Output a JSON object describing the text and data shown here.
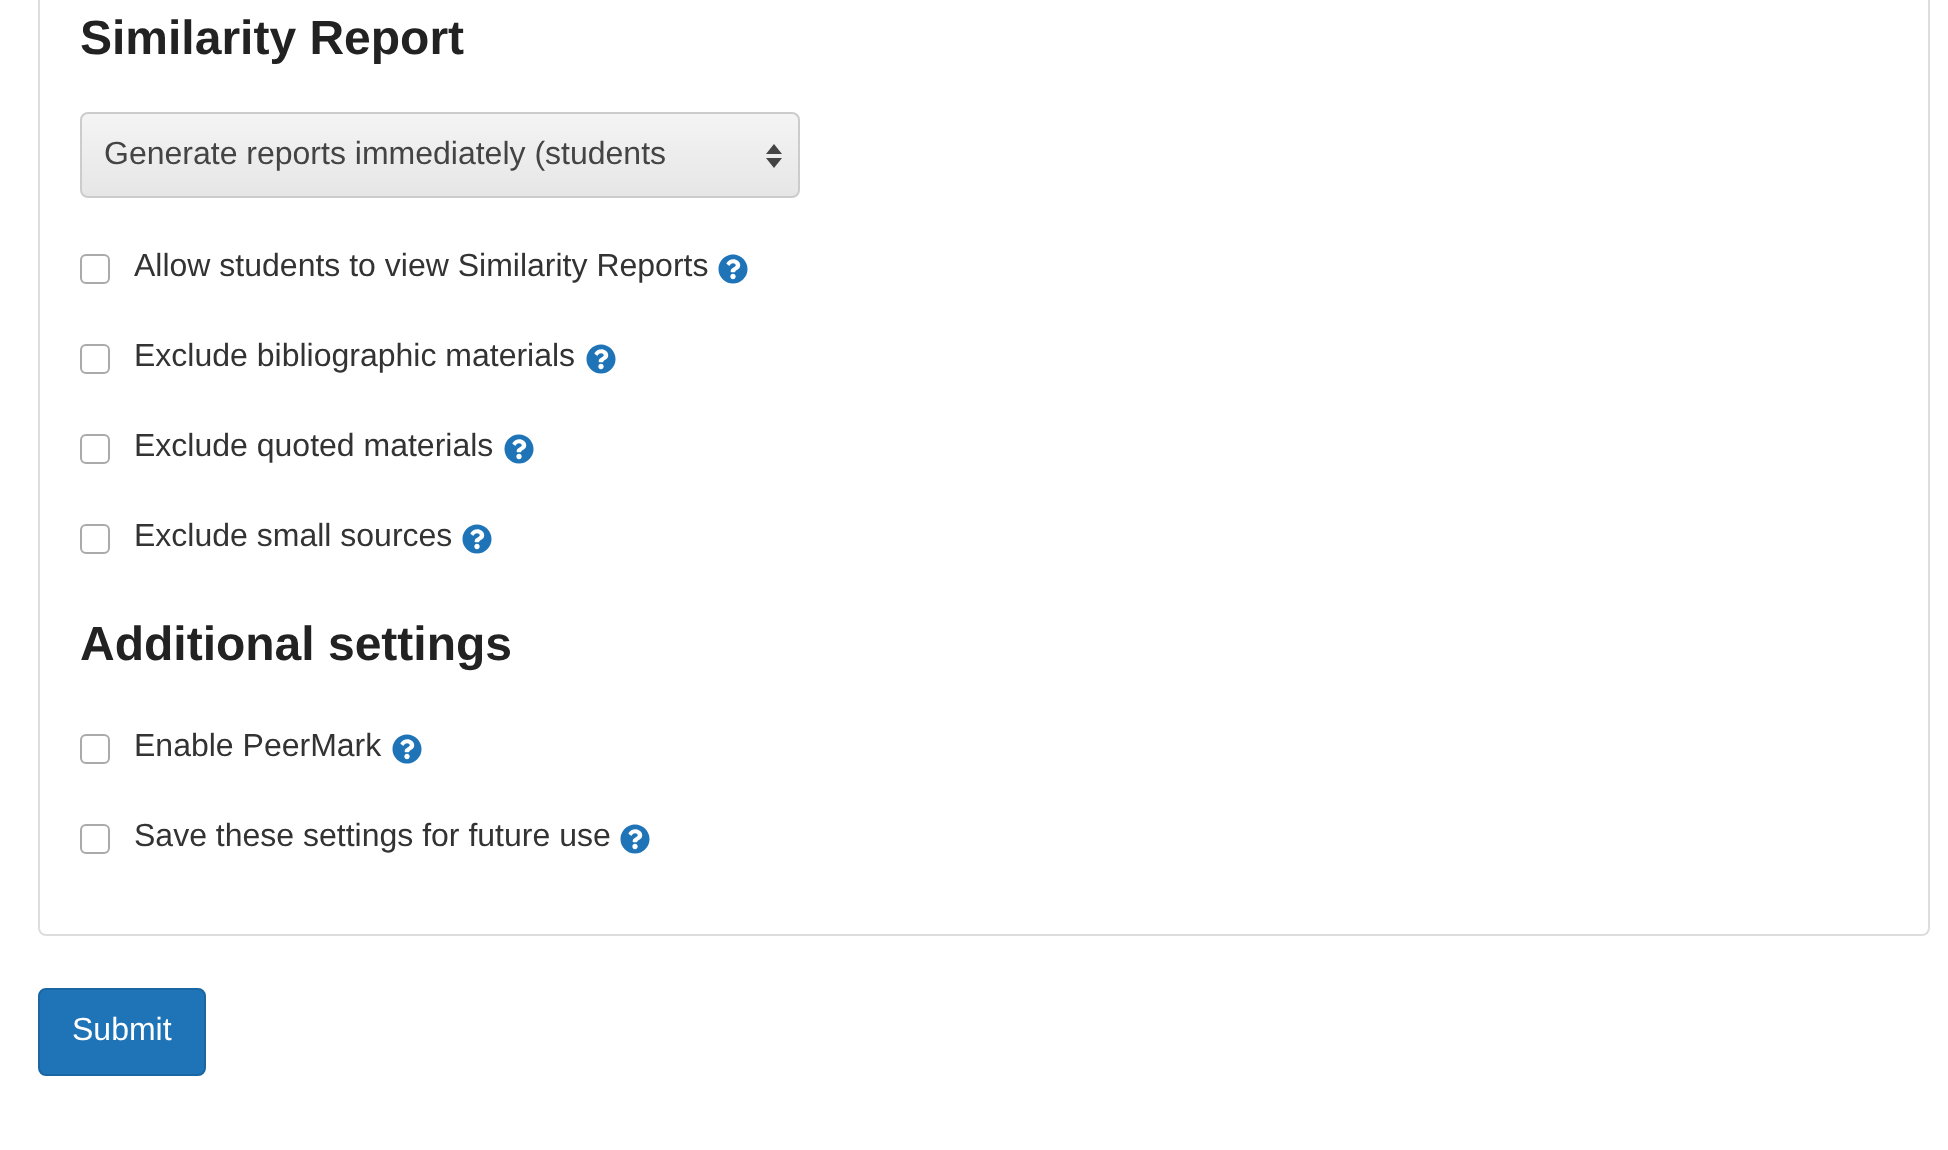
{
  "sections": [
    {
      "title": "Similarity Report",
      "select": {
        "value": "Generate reports immediately (students"
      },
      "options": [
        {
          "label": "Allow students to view Similarity Reports",
          "checked": false
        },
        {
          "label": "Exclude bibliographic materials",
          "checked": false
        },
        {
          "label": "Exclude quoted materials",
          "checked": false
        },
        {
          "label": "Exclude small sources",
          "checked": false
        }
      ]
    },
    {
      "title": "Additional settings",
      "options": [
        {
          "label": "Enable PeerMark",
          "checked": false
        },
        {
          "label": "Save these settings for future use",
          "checked": false
        }
      ]
    }
  ],
  "submit": "Submit"
}
